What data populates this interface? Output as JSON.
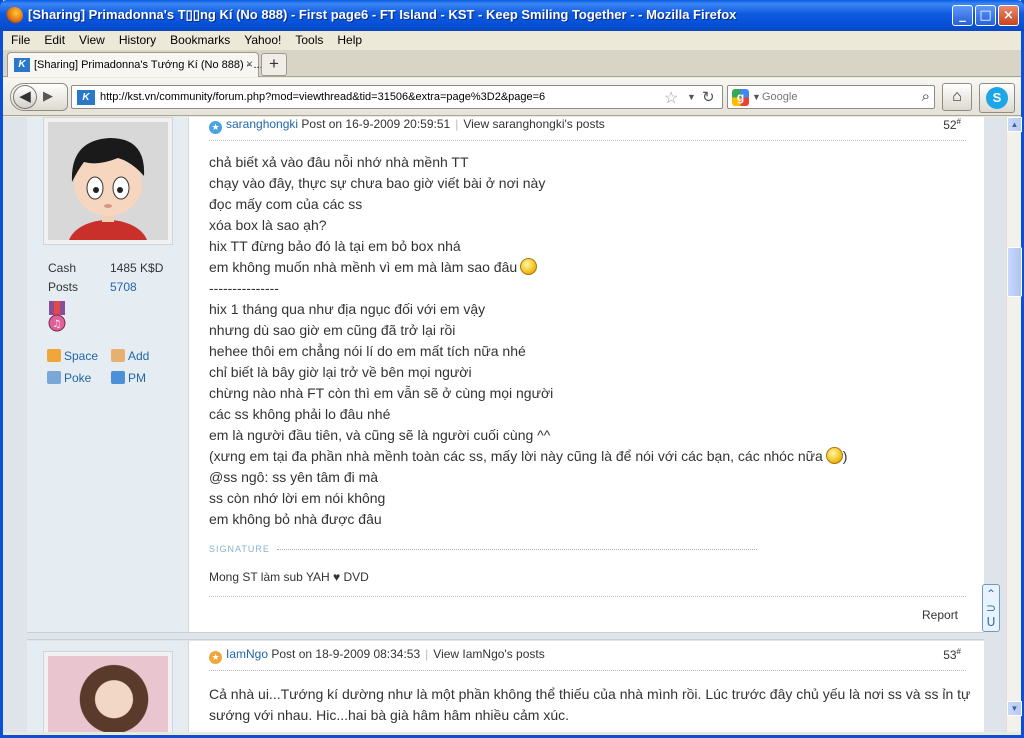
{
  "window": {
    "title": "[Sharing] Primadonna's T▯▯ng Kí (No 888) - First page6 - FT Island - KST - Keep Smiling Together - - Mozilla Firefox"
  },
  "menu": [
    "File",
    "Edit",
    "View",
    "History",
    "Bookmarks",
    "Yahoo!",
    "Tools",
    "Help"
  ],
  "tab": {
    "label": "[Sharing] Primadonna's Tướng Kí (No 888) - ...",
    "close": "×",
    "new": "+"
  },
  "nav": {
    "url": "http://kst.vn/community/forum.php?mod=viewthread&tid=31506&extra=page%3D2&page=6",
    "search_placeholder": "Google"
  },
  "posts": [
    {
      "author": "saranghongki",
      "posted": "Post on 16-9-2009 20:59:51",
      "view_link": "View saranghongki's posts",
      "number": "52",
      "stats": {
        "cash_label": "Cash",
        "cash_value": "1485 K$D",
        "posts_label": "Posts",
        "posts_value": "5708"
      },
      "actions": {
        "space": "Space",
        "add": "Add",
        "poke": "Poke",
        "pm": "PM"
      },
      "lines": [
        "chả biết xả vào đâu nỗi nhớ nhà mềnh TT",
        "chạy vào đây, thực sự chưa bao giờ viết bài ở nơi này",
        "đọc mấy com của các ss",
        "xóa box là sao ạh?",
        "hix TT đừng bảo đó là tại em bỏ box nhá",
        "em không muốn nhà mềnh vì em mà làm sao đâu",
        "---------------",
        "hix 1 tháng qua như địa ngục đối với em vậy",
        "nhưng dù sao giờ em cũng đã trở lại rồi",
        "hehee thôi em chẳng nói lí do em mất tích nữa nhé",
        "chỉ biết là bây giờ lại trở về bên mọi người",
        "chừng nào nhà FT còn thì em vẫn sẽ ở cùng mọi người",
        "các ss không phải lo đâu nhé",
        "em là người đầu tiên, và cũng sẽ là người cuối cùng ^^",
        "(xưng em tại đa phần nhà mềnh toàn các ss, mấy lời này cũng là để nói với các bạn, các nhóc nữa",
        "@ss ngô: ss yên tâm đi mà",
        "ss còn nhớ lời em nói không",
        "em không bỏ nhà được đâu"
      ],
      "line15_close": ")",
      "signature_label": "SIGNATURE",
      "signature": "Mong ST làm sub YAH ♥ DVD",
      "report": "Report"
    },
    {
      "author": "IamNgo",
      "posted": "Post on 18-9-2009 08:34:53",
      "view_link": "View IamNgo's posts",
      "number": "53",
      "lines": [
        "Cả nhà ui...Tướng kí dường như là một phần không thể thiếu của nhà mình rồi. Lúc trước đây chủ yếu là nơi ss và ss ỉn tự",
        "sướng với nhau. Hic...hai bà già hâm hâm nhiều cảm xúc."
      ]
    }
  ],
  "colors": {
    "link": "#2366a8",
    "title_bar": "#0a5fe8",
    "sidebar": "#e5edf2"
  }
}
